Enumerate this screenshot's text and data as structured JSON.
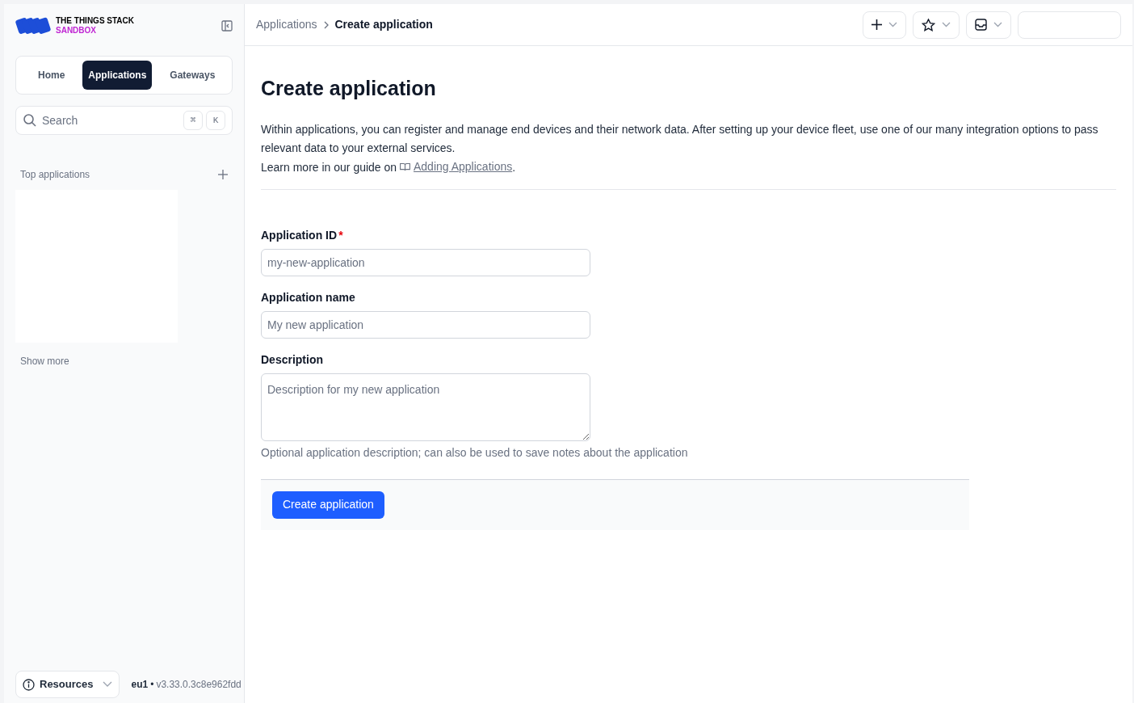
{
  "sidebar": {
    "brand": {
      "line_1": "THE THINGS STACK",
      "line_2": "SANDBOX"
    },
    "nav_tabs": [
      {
        "label": "Home",
        "selected": false
      },
      {
        "label": "Applications",
        "selected": true
      },
      {
        "label": "Gateways",
        "selected": false
      }
    ],
    "search": {
      "placeholder": "Search",
      "shortcut_keys": [
        "⌘",
        "K"
      ]
    },
    "top_applications": {
      "heading": "Top applications",
      "show_more": "Show more"
    },
    "footer": {
      "resources": "Resources",
      "region": "eu1",
      "separator": "•",
      "version": "v3.33.0.3c8e962fdd"
    }
  },
  "header": {
    "breadcrumbs": [
      {
        "label": "Applications",
        "current": false
      },
      {
        "label": "Create application",
        "current": true
      }
    ]
  },
  "page": {
    "title": "Create application",
    "intro": "Within applications, you can register and manage end devices and their network data. After setting up your device fleet, use one of our many integration options to pass relevant data to your external services.",
    "guide": {
      "prefix": "Learn more in our guide on",
      "link": "Adding Applications",
      "suffix": "."
    },
    "fields": [
      {
        "kind": "input",
        "label": "Application ID",
        "required_mark": "*",
        "placeholder": "my-new-application"
      },
      {
        "kind": "input",
        "label": "Application name",
        "placeholder": "My new application"
      },
      {
        "kind": "textarea",
        "label": "Description",
        "placeholder": "Description for my new application",
        "hint": "Optional application description; can also be used to save notes about the application"
      }
    ],
    "submit": "Create application"
  }
}
